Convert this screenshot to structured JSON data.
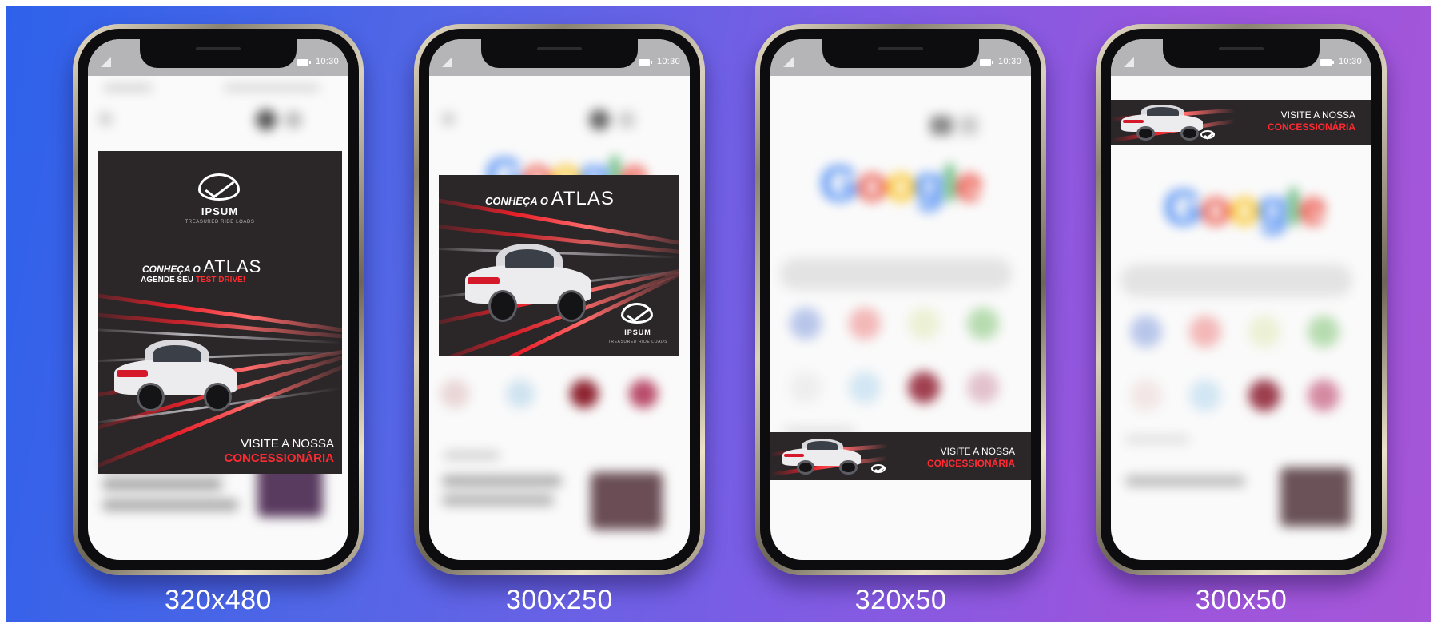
{
  "status_bar": {
    "time": "10:30"
  },
  "brand": {
    "name": "IPSUM",
    "tagline": "TREASURED RIDE LOADS"
  },
  "ad_copy": {
    "headline_prefix": "CONHEÇA O",
    "model": "ATLAS",
    "sub_prefix": "AGENDE SEU",
    "sub_highlight": "TEST DRIVE!",
    "cta_line1": "VISITE A NOSSA",
    "cta_line2": "CONCESSIONÁRIA"
  },
  "background_page": {
    "search_logo_letters": [
      "G",
      "o",
      "o",
      "g",
      "l",
      "e"
    ]
  },
  "formats": [
    {
      "label": "320x480"
    },
    {
      "label": "300x250"
    },
    {
      "label": "320x50"
    },
    {
      "label": "300x50"
    }
  ],
  "colors": {
    "accent_red": "#ff2a32",
    "ad_background": "#2b2628"
  }
}
